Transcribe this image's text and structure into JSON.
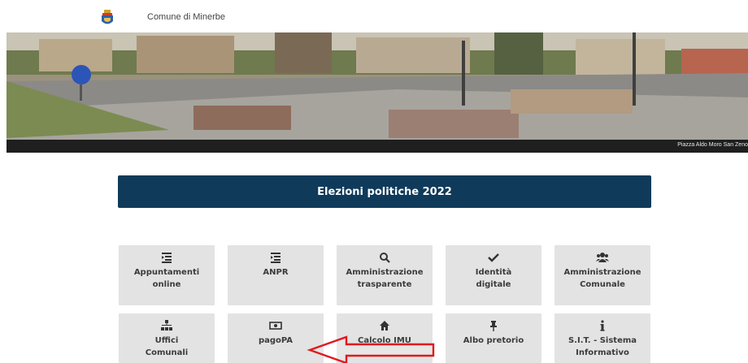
{
  "header": {
    "site_title": "Comune di Minerbe"
  },
  "hero": {
    "caption": "Piazza Aldo Moro San Zeno"
  },
  "banner": {
    "label": "Elezioni politiche 2022"
  },
  "tiles_row1": [
    {
      "icon": "list-icon",
      "line1": "Appuntamenti",
      "line2": "online"
    },
    {
      "icon": "list-icon",
      "line1": "ANPR",
      "line2": ""
    },
    {
      "icon": "search-icon",
      "line1": "Amministrazione",
      "line2": "trasparente"
    },
    {
      "icon": "check-icon",
      "line1": "Identità",
      "line2": "digitale"
    },
    {
      "icon": "users-icon",
      "line1": "Amministrazione",
      "line2": "Comunale"
    }
  ],
  "tiles_row2": [
    {
      "icon": "sitemap-icon",
      "line1": "Uffici",
      "line2": "Comunali"
    },
    {
      "icon": "money-icon",
      "line1": "pagoPA",
      "line2": ""
    },
    {
      "icon": "home-icon",
      "line1": "Calcolo IMU",
      "line2": ""
    },
    {
      "icon": "pin-icon",
      "line1": "Albo pretorio",
      "line2": ""
    },
    {
      "icon": "info-icon",
      "line1": "S.I.T. - Sistema",
      "line2": "Informativo"
    }
  ],
  "colors": {
    "banner": "#0f3a5a",
    "tile": "#e3e3e3",
    "annotation_arrow": "#e0191f"
  }
}
